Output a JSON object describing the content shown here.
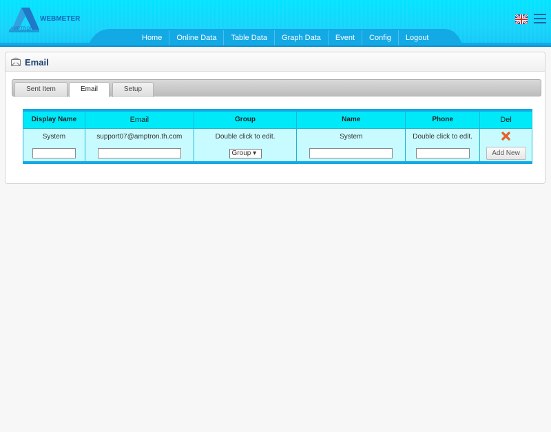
{
  "header": {
    "brand": "WEBMETER",
    "logo_sub": "AMPTRON",
    "nav": [
      "Home",
      "Online Data",
      "Table Data",
      "Graph Data",
      "Event",
      "Config",
      "Logout"
    ]
  },
  "panel": {
    "title": "Email",
    "tabs": [
      "Sent Item",
      "Email",
      "Setup"
    ],
    "active_tab": "Email"
  },
  "table": {
    "headers": [
      "Display Name",
      "Email",
      "Group",
      "Name",
      "Phone",
      "Del"
    ],
    "row": {
      "display_name": "System",
      "email": "support07@amptron.th.com",
      "group": "Double click to edit.",
      "name": "System",
      "phone": "Double click to edit."
    },
    "new_row": {
      "group_select": "Group",
      "add_button": "Add New"
    }
  },
  "colors": {
    "header_top": "#00e4ff",
    "nav_band": "#13a9e5",
    "table_header": "#00e9f9",
    "table_body": "#c7fbff",
    "delete": "#e8622a"
  }
}
